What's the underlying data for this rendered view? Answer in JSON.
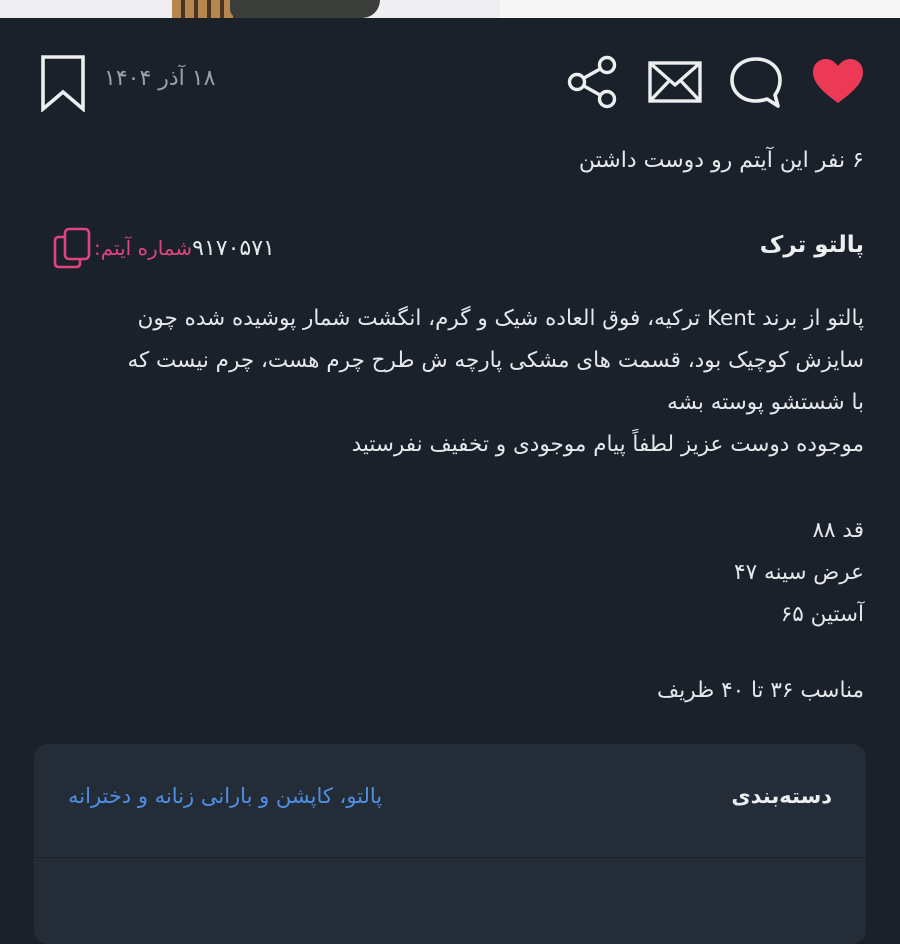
{
  "post": {
    "date": "۱۸ آذر ۱۴۰۴",
    "likes_text": "۶ نفر این آیتم رو دوست داشتن",
    "title": "پالتو ترک",
    "item_id_label": "شماره آیتم:",
    "item_id_value": "۹۱۷۰۵۷۱",
    "description_lines": [
      "پالتو از برند Kent ترکیه، فوق العاده شیک و گرم، انگشت شمار پوشیده شده چون",
      "سایزش کوچیک بود، قسمت های مشکی پارچه ش طرح چرم هست، چرم نیست که",
      "با شستشو پوسته بشه",
      "موجوده دوست عزیز لطفاً پیام موجودی و تخفیف نفرستید"
    ],
    "measurements": [
      "قد ۸۸",
      "عرض سینه ۴۷",
      "آستین ۶۵"
    ],
    "suitable": "مناسب ۳۶ تا ۴۰ ظریف"
  },
  "category": {
    "label": "دسته‌بندی",
    "value": "پالتو، کاپشن و بارانی زنانه و دخترانه"
  },
  "icons": {
    "like": "heart-icon",
    "comment": "comment-bubble-icon",
    "mail": "envelope-icon",
    "share": "share-icon",
    "bookmark": "bookmark-icon",
    "copy": "copy-icon"
  },
  "colors": {
    "background": "#1a212b",
    "heart": "#ec3a56",
    "accent_pink": "#e0447f",
    "link_blue": "#4f8fe3",
    "card": "#242c37"
  }
}
